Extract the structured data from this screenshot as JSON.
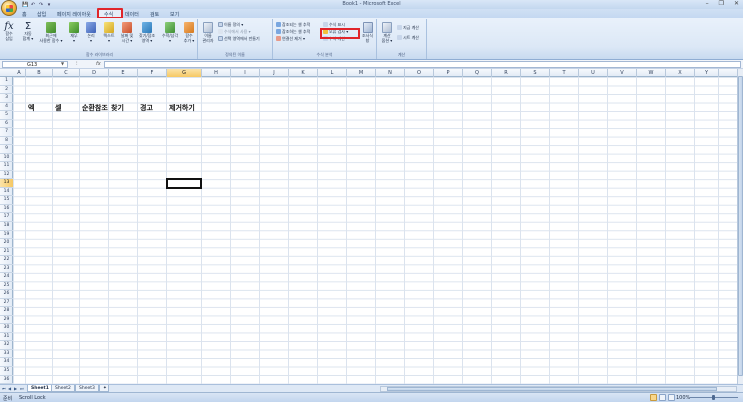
{
  "window": {
    "title": "Book1 - Microsoft Excel",
    "controls": [
      "–",
      "❐",
      "✕"
    ]
  },
  "qat": [
    "💾",
    "↶",
    "↷",
    "▾"
  ],
  "tabs": [
    {
      "label": "홈"
    },
    {
      "label": "삽입"
    },
    {
      "label": "페이지 레이아웃"
    },
    {
      "label": "수식"
    },
    {
      "label": "데이터"
    },
    {
      "label": "검토"
    },
    {
      "label": "보기"
    }
  ],
  "ribbon": {
    "groups": {
      "function_library": "함수 라이브러리",
      "defined_names": "정의된 이름",
      "formula_auditing": "수식 분석",
      "calculation": "계산"
    },
    "buttons": {
      "insert_function": "함수\n삽입",
      "autosum": "자동\n합계 ▾",
      "recent": "최근에\n사용한 함수 ▾",
      "financial": "재무\n▾",
      "logical": "논리\n▾",
      "text": "텍스트\n▾",
      "datetime": "날짜 및\n시간 ▾",
      "lookup": "찾기/참조\n영역 ▾",
      "math": "수학/삼각\n▾",
      "more": "함수\n추가 ▾",
      "name_manager": "이름\n관리자",
      "define_name": "이름 정의 ▾",
      "use_in_formula": "수식에서 사용 ▾",
      "create_from_selection": "선택 영역에서 만들기",
      "trace_precedents": "참조되는 셀 추적",
      "trace_dependents": "참조하는 셀 추적",
      "remove_arrows": "연결선 제거 ▾",
      "show_formulas": "수식 표시",
      "error_checking": "오류 검사 ▾",
      "evaluate_formula": "수식 계산",
      "watch_window": "조사식\n창",
      "calc_options": "계산\n옵션 ▾",
      "calc_now": "지금 계산",
      "calc_sheet": "시트 계산"
    }
  },
  "formula_bar": {
    "name_box": "G13",
    "fx": "fx",
    "value": ""
  },
  "columns": [
    "A",
    "B",
    "C",
    "D",
    "E",
    "F",
    "G",
    "H",
    "I",
    "J",
    "K",
    "L",
    "M",
    "N",
    "O",
    "P",
    "Q",
    "R",
    "S",
    "T",
    "U",
    "V",
    "W",
    "X",
    "Y"
  ],
  "rows": [
    "1",
    "2",
    "3",
    "4",
    "5",
    "6",
    "7",
    "8",
    "9",
    "10",
    "11",
    "12",
    "13",
    "14",
    "15",
    "16",
    "17",
    "18",
    "19",
    "20",
    "21",
    "22",
    "23",
    "24",
    "25",
    "26",
    "27",
    "28",
    "29",
    "30",
    "31",
    "32",
    "33",
    "34",
    "35",
    "36"
  ],
  "cells": [
    {
      "ref": "B4",
      "text": "엑"
    },
    {
      "ref": "C4",
      "text": "셀"
    },
    {
      "ref": "D4",
      "text": "순환참조"
    },
    {
      "ref": "E4",
      "text": "찾기"
    },
    {
      "ref": "F4",
      "text": "경고"
    },
    {
      "ref": "G4",
      "text": "제거하기"
    }
  ],
  "selected_cell": "G13",
  "sheets": [
    "Sheet1",
    "Sheet2",
    "Sheet3"
  ],
  "active_sheet": "Sheet1",
  "status": {
    "ready": "준비",
    "scroll_lock": "Scroll Lock",
    "zoom": "100%"
  },
  "colors": {
    "highlight": "#e0252a",
    "selection_header": "#f6c863"
  }
}
